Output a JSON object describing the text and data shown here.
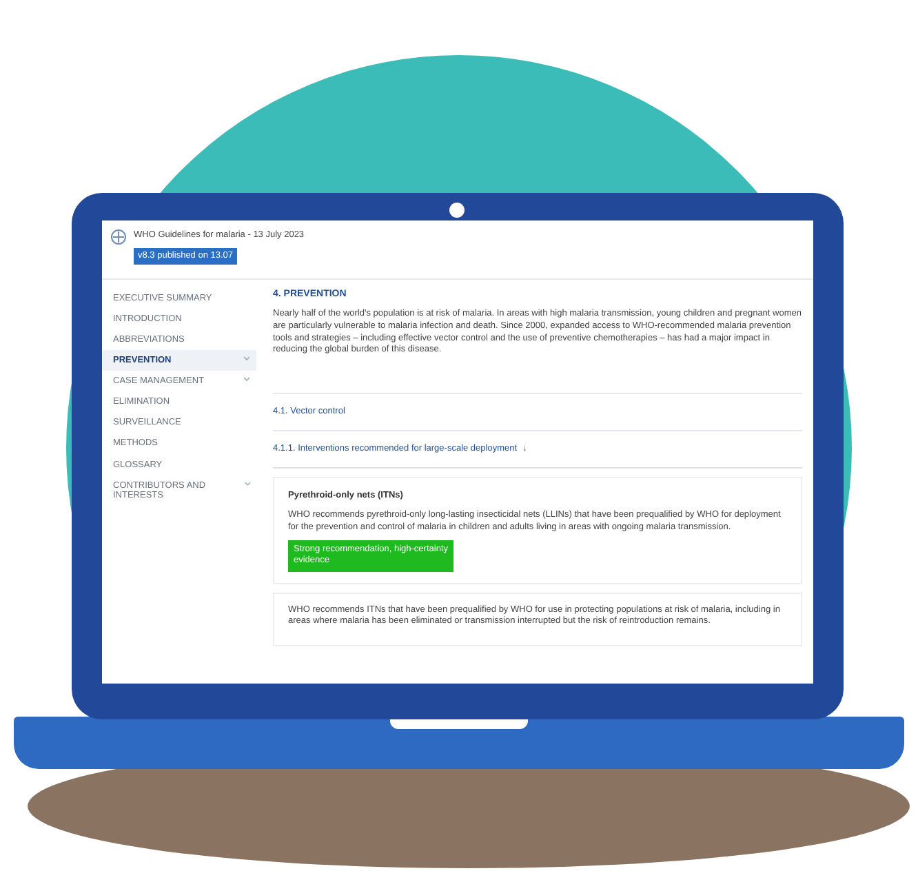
{
  "header": {
    "title": "WHO Guidelines for malaria - 13 July 2023",
    "version_badge": "v8.3 published on 13.07"
  },
  "sidebar": {
    "items": [
      {
        "label": "EXECUTIVE SUMMARY",
        "selected": false,
        "expandable": false
      },
      {
        "label": "INTRODUCTION",
        "selected": false,
        "expandable": false
      },
      {
        "label": "ABBREVIATIONS",
        "selected": false,
        "expandable": false
      },
      {
        "label": "PREVENTION",
        "selected": true,
        "expandable": true
      },
      {
        "label": "CASE MANAGEMENT",
        "selected": false,
        "expandable": true
      },
      {
        "label": "ELIMINATION",
        "selected": false,
        "expandable": false
      },
      {
        "label": "SURVEILLANCE",
        "selected": false,
        "expandable": false
      },
      {
        "label": "METHODS",
        "selected": false,
        "expandable": false
      },
      {
        "label": "GLOSSARY",
        "selected": false,
        "expandable": false
      },
      {
        "label": "CONTRIBUTORS AND INTERESTS",
        "selected": false,
        "expandable": true
      }
    ]
  },
  "content": {
    "heading": "4. PREVENTION",
    "intro": "Nearly half of the world's population is at risk of malaria. In areas with high malaria transmission, young children and pregnant women are particularly vulnerable to malaria infection and death. Since 2000, expanded access to WHO-recommended malaria prevention tools and strategies – including effective vector control and the use of preventive chemotherapies – has had a major impact in reducing the global burden of this disease.",
    "section": "4.1. Vector control",
    "subsection": "4.1.1. Interventions recommended for large-scale deployment",
    "subsection_icon": "↓",
    "recommendations": [
      {
        "title": "Pyrethroid-only nets (ITNs)",
        "text": "WHO recommends pyrethroid-only long-lasting insecticidal nets (LLINs) that have been prequalified by WHO for deployment for the prevention and control of malaria in children and adults living in areas with ongoing malaria transmission.",
        "strength": "Strong recommendation, high-certainty evidence",
        "color": "#1fba1f"
      },
      {
        "text": "WHO recommends ITNs that have been prequalified by WHO for use in protecting populations at risk of malaria, including in areas where malaria has been eliminated or transmission interrupted but the risk of reintroduction remains."
      }
    ]
  }
}
